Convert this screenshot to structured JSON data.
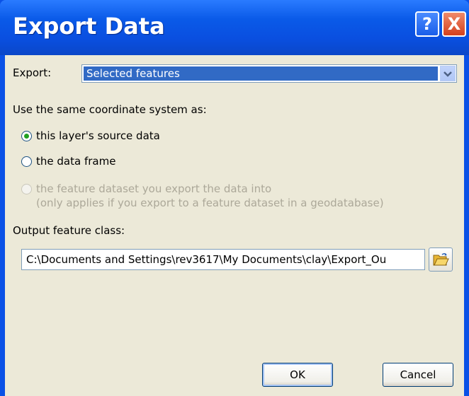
{
  "window": {
    "title": "Export Data",
    "help_label": "?",
    "close_label": "X"
  },
  "export": {
    "label": "Export:",
    "selected": "Selected features"
  },
  "coord": {
    "heading": "Use the same coordinate system as:",
    "options": [
      {
        "label": "this layer's source data",
        "checked": true,
        "enabled": true
      },
      {
        "label": "the data frame",
        "checked": false,
        "enabled": true
      },
      {
        "label": "the feature dataset you export the data into",
        "sub": "(only applies if you export to a feature dataset in a geodatabase)",
        "checked": false,
        "enabled": false
      }
    ]
  },
  "output": {
    "label": "Output feature class:",
    "value": "C:\\Documents and Settings\\rev3617\\My Documents\\clay\\Export_Ou"
  },
  "buttons": {
    "ok": "OK",
    "cancel": "Cancel"
  }
}
